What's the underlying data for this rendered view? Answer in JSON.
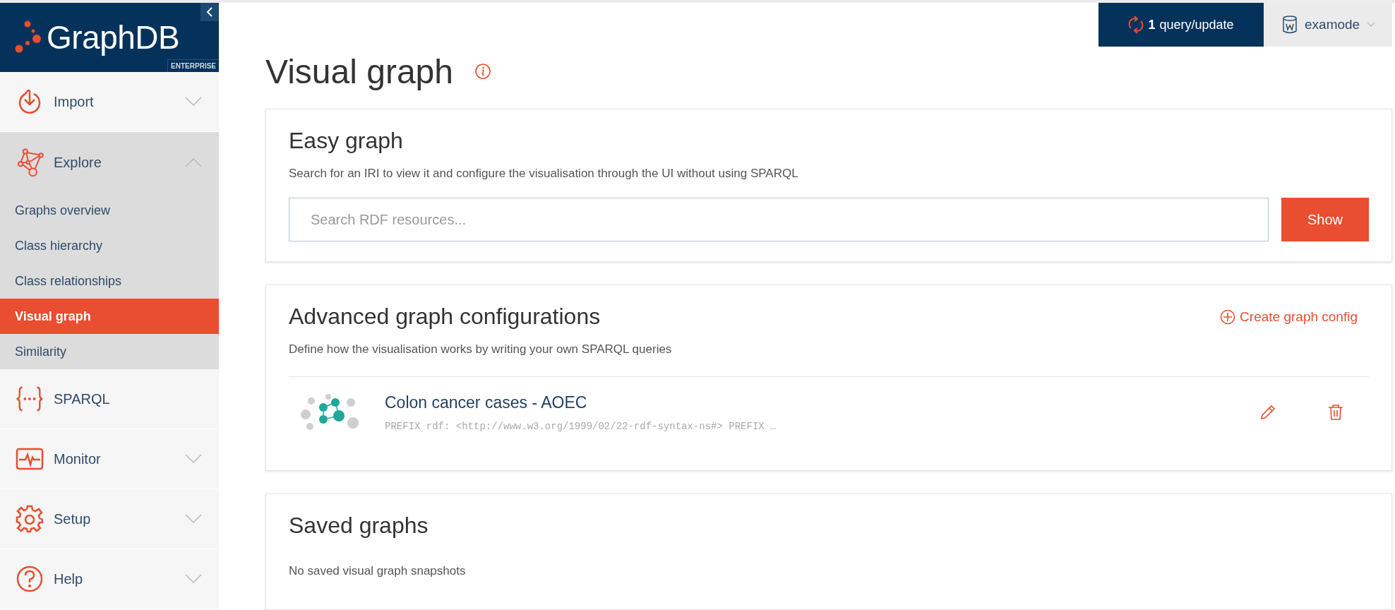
{
  "sidebar": {
    "logo": {
      "name": "GraphDB",
      "edition": "ENTERPRISE"
    },
    "items": [
      {
        "label": "Import",
        "kind": "import",
        "expanded": false
      },
      {
        "label": "Explore",
        "kind": "explore",
        "expanded": true,
        "children": [
          {
            "label": "Graphs overview",
            "selected": false
          },
          {
            "label": "Class hierarchy",
            "selected": false
          },
          {
            "label": "Class relationships",
            "selected": false
          },
          {
            "label": "Visual graph",
            "selected": true
          },
          {
            "label": "Similarity",
            "selected": false
          }
        ]
      },
      {
        "label": "SPARQL",
        "kind": "sparql"
      },
      {
        "label": "Monitor",
        "kind": "monitor",
        "expanded": false
      },
      {
        "label": "Setup",
        "kind": "setup",
        "expanded": false
      },
      {
        "label": "Help",
        "kind": "help",
        "expanded": false
      }
    ]
  },
  "topbar": {
    "operations": {
      "count": "1",
      "label": "query/update"
    },
    "repository": "examode"
  },
  "page": {
    "title": "Visual graph",
    "easy_graph": {
      "title": "Easy graph",
      "description": "Search for an IRI to view it and configure the visualisation through the UI without using SPARQL",
      "search": {
        "placeholder": "Search RDF resources..."
      },
      "button": "Show"
    },
    "advanced": {
      "title": "Advanced graph configurations",
      "create": "Create graph config",
      "description": "Define how the visualisation works by writing your own SPARQL queries",
      "configs": [
        {
          "name": "Colon cancer cases - AOEC",
          "query": "PREFIX rdf: <http://www.w3.org/1999/02/22-rdf-syntax-ns#> PREFIX …"
        }
      ]
    },
    "saved": {
      "title": "Saved graphs",
      "empty": "No saved visual graph snapshots"
    }
  }
}
